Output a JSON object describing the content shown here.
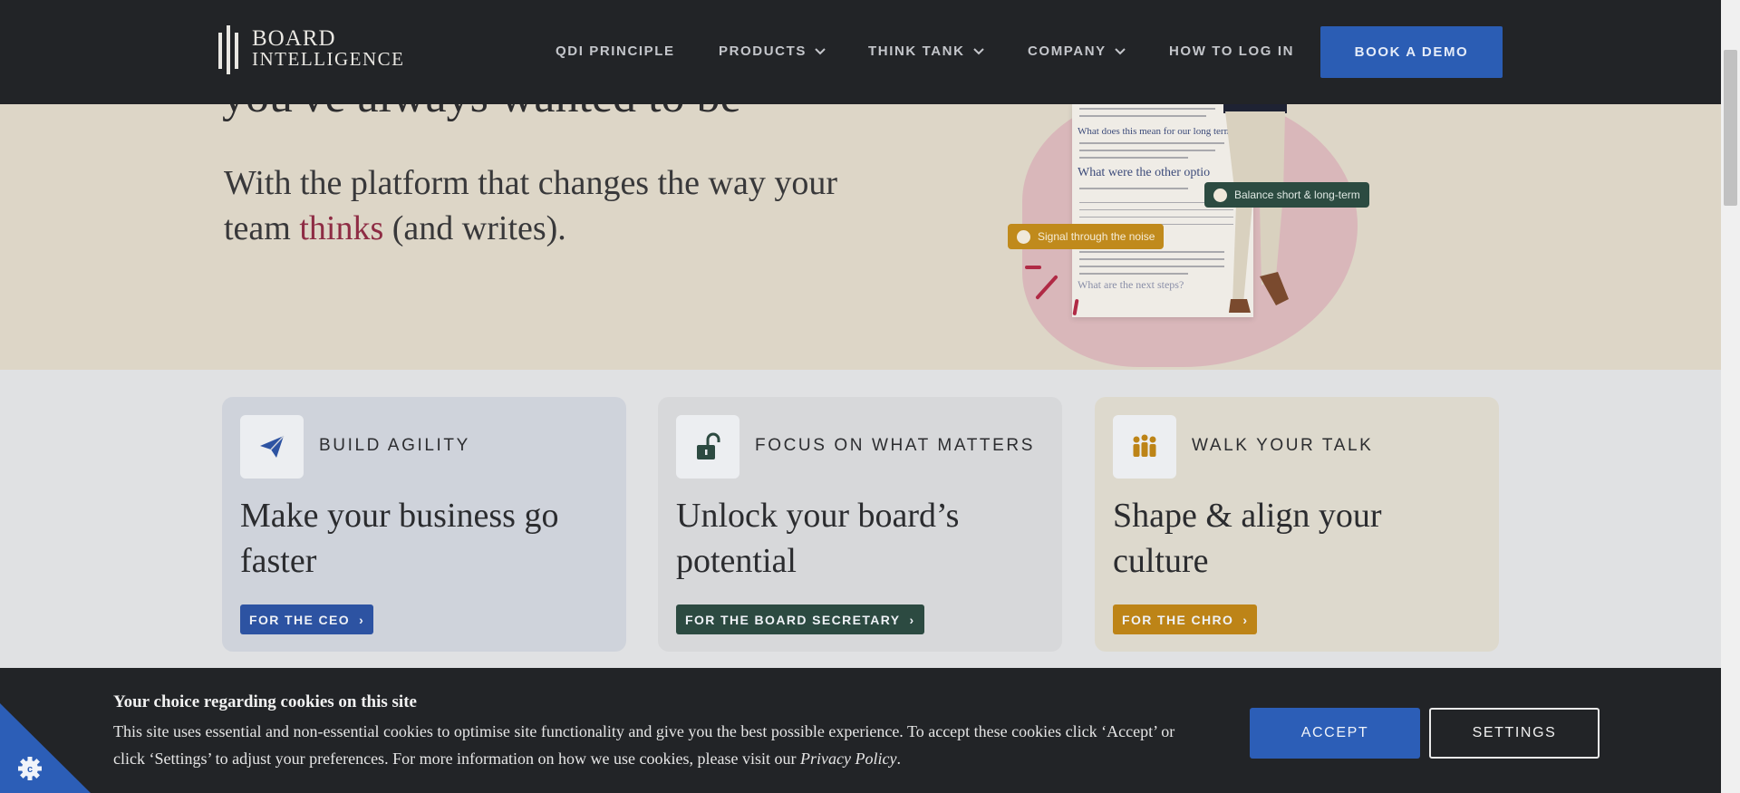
{
  "header": {
    "logo": {
      "line1": "BOARD",
      "line2": "INTELLIGENCE"
    },
    "nav": [
      {
        "label": "QDI PRINCIPLE",
        "has_dropdown": false
      },
      {
        "label": "PRODUCTS",
        "has_dropdown": true
      },
      {
        "label": "THINK TANK",
        "has_dropdown": true
      },
      {
        "label": "COMPANY",
        "has_dropdown": true
      },
      {
        "label": "HOW TO LOG IN",
        "has_dropdown": false
      }
    ],
    "cta": "BOOK A DEMO"
  },
  "hero": {
    "headline": "you've always wanted to be",
    "sub_before": "With the platform that changes the way your team ",
    "sub_highlight": "thinks",
    "sub_after": " (and writes).",
    "doc": {
      "heading1": "What does this mean for our long term b",
      "heading2": "What were the other optio",
      "heading3": "What are the next steps?"
    },
    "chips": {
      "gold": "Signal through the noise",
      "green": "Balance short & long-term"
    }
  },
  "cards": [
    {
      "eyebrow": "BUILD AGILITY",
      "title": "Make your business go faster",
      "button": "FOR THE CEO",
      "icon": "paper-plane-icon"
    },
    {
      "eyebrow": "FOCUS ON WHAT MATTERS",
      "title": "Unlock your board’s potential",
      "button": "FOR THE BOARD SECRETARY",
      "icon": "unlock-icon"
    },
    {
      "eyebrow": "WALK YOUR TALK",
      "title": "Shape & align your culture",
      "button": "FOR THE CHRO",
      "icon": "people-group-icon"
    }
  ],
  "cookie": {
    "title": "Your choice regarding cookies on this site",
    "text_before": "This site uses essential and non-essential cookies to optimise site functionality and give you the best possible experience. To accept these cookies click ‘Accept’ or click ‘Settings’ to adjust your preferences. For more information on how we use cookies, please visit our ",
    "policy_link": "Privacy Policy",
    "text_after": ".",
    "accept": "ACCEPT",
    "settings": "SETTINGS"
  },
  "colors": {
    "header_bg": "#222427",
    "accent_blue": "#2b5db4",
    "board_green": "#2c4a41",
    "chro_gold": "#bd8417",
    "hero_bg": "#ddd6c7"
  }
}
